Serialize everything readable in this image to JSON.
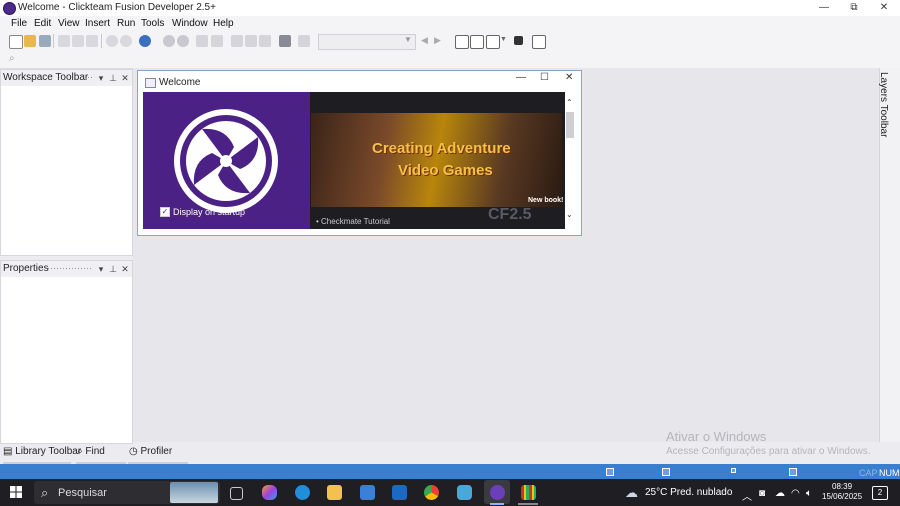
{
  "window": {
    "title": "Welcome - Clickteam Fusion Developer 2.5+",
    "controls": {
      "minimize": "—",
      "maximize": "⧉",
      "close": "✕"
    }
  },
  "menu": [
    "File",
    "Edit",
    "View",
    "Insert",
    "Run",
    "Tools",
    "Window",
    "Help"
  ],
  "panels": {
    "workspace": {
      "title": "Workspace Toolbar"
    },
    "properties": {
      "title": "Properties"
    },
    "layers": {
      "title": "Layers Toolbar"
    }
  },
  "welcome_window": {
    "title": "Welcome",
    "display_on_startup": "Display on startup",
    "display_on_startup_checked": true,
    "banner_line1": "Creating Adventure",
    "banner_line2": "Video Games",
    "banner_badge": "New book!",
    "tutorial_link": "• Checkmate Tutorial",
    "product_logo": "CF2.5"
  },
  "bottom_tabs": [
    "Library Toolbar",
    "Find",
    "Profiler"
  ],
  "status": {
    "caps": "CAP",
    "num": "NUM"
  },
  "watermark": {
    "line1": "Ativar o Windows",
    "line2": "Acesse Configurações para ativar o Windows."
  },
  "taskbar": {
    "search_placeholder": "Pesquisar",
    "weather_temp": "25°C",
    "weather_text": "Pred. nublado",
    "time": "08:39",
    "date": "15/06/2025",
    "notification_count": "2"
  },
  "colors": {
    "accent": "#4b2185",
    "statusbar": "#3a7fcf",
    "taskbar": "#1f1f23"
  }
}
